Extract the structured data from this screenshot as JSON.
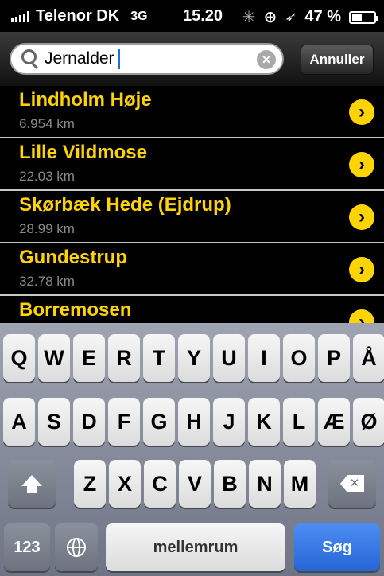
{
  "status_bar": {
    "carrier": "Telenor DK",
    "network": "3G",
    "time": "15.20",
    "battery": "47 %",
    "battery_level": 0.47
  },
  "search": {
    "query": "Jernalder",
    "cancel_label": "Annuller"
  },
  "results": [
    {
      "name": "Lindholm Høje",
      "distance": "6.954 km"
    },
    {
      "name": "Lille Vildmose",
      "distance": "22.03 km"
    },
    {
      "name": "Skørbæk Hede (Ejdrup)",
      "distance": "28.99 km"
    },
    {
      "name": "Gundestrup",
      "distance": "32.78 km"
    },
    {
      "name": "Borremosen",
      "distance": ""
    }
  ],
  "keyboard": {
    "row1": [
      "Q",
      "W",
      "E",
      "R",
      "T",
      "Y",
      "U",
      "I",
      "O",
      "P",
      "Å"
    ],
    "row2": [
      "A",
      "S",
      "D",
      "F",
      "G",
      "H",
      "J",
      "K",
      "L",
      "Æ",
      "Ø"
    ],
    "row3": [
      "Z",
      "X",
      "C",
      "V",
      "B",
      "N",
      "M"
    ],
    "numbers_label": "123",
    "space_label": "mellemrum",
    "return_label": "Søg"
  },
  "colors": {
    "accent": "#ffd400",
    "distance": "#8a8a8a",
    "return_key": "#2565d6"
  }
}
